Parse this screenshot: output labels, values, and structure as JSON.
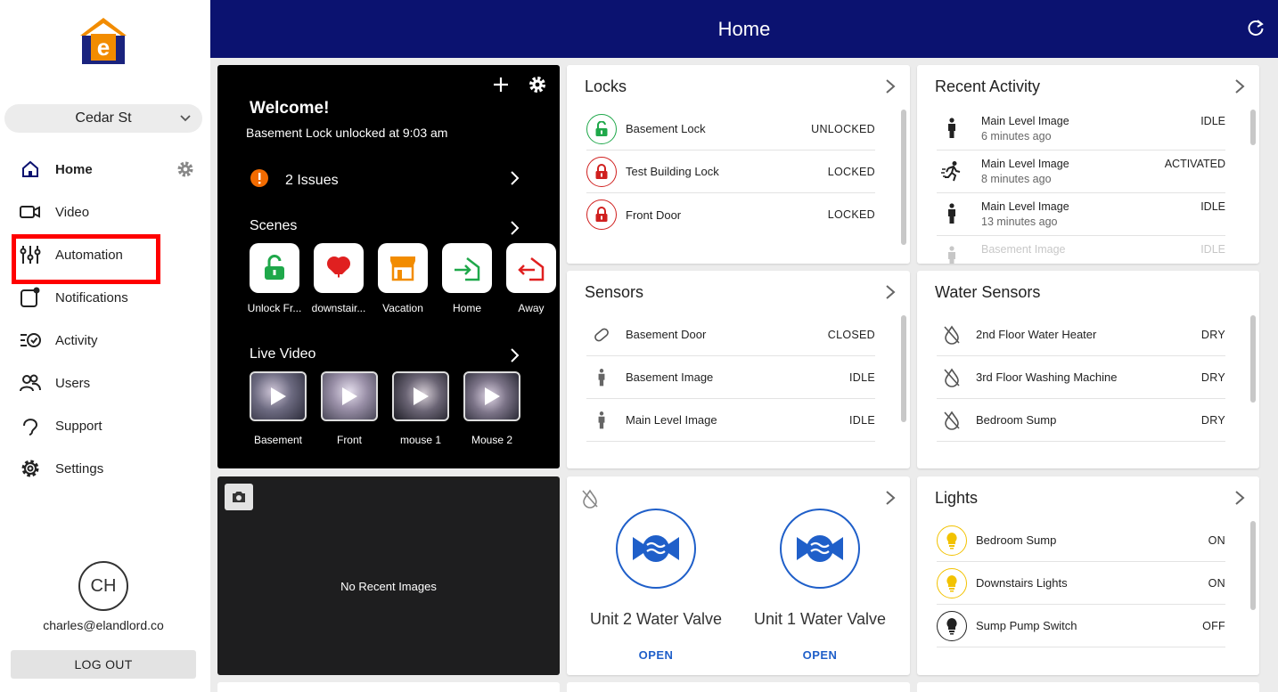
{
  "header": {
    "title": "Home"
  },
  "sidebar": {
    "property": "Cedar St",
    "nav": [
      {
        "label": "Home"
      },
      {
        "label": "Video"
      },
      {
        "label": "Automation"
      },
      {
        "label": "Notifications"
      },
      {
        "label": "Activity"
      },
      {
        "label": "Users"
      },
      {
        "label": "Support"
      },
      {
        "label": "Settings"
      }
    ],
    "avatar_initials": "CH",
    "email": "charles@elandlord.co",
    "logout_label": "LOG OUT"
  },
  "welcome": {
    "title": "Welcome!",
    "subtitle": "Basement Lock unlocked at 9:03 am",
    "issues": "2 Issues",
    "scenes_title": "Scenes",
    "scenes": [
      {
        "label": "Unlock Fr..."
      },
      {
        "label": "downstair..."
      },
      {
        "label": "Vacation"
      },
      {
        "label": "Home"
      },
      {
        "label": "Away"
      }
    ],
    "video_title": "Live Video",
    "videos": [
      {
        "label": "Basement"
      },
      {
        "label": "Front"
      },
      {
        "label": "mouse 1"
      },
      {
        "label": "Mouse 2"
      }
    ]
  },
  "locks": {
    "title": "Locks",
    "items": [
      {
        "label": "Basement Lock",
        "status": "UNLOCKED"
      },
      {
        "label": "Test Building Lock",
        "status": "LOCKED"
      },
      {
        "label": "Front Door",
        "status": "LOCKED"
      }
    ]
  },
  "activity": {
    "title": "Recent Activity",
    "items": [
      {
        "label": "Main Level Image",
        "time": "6 minutes ago",
        "status": "IDLE"
      },
      {
        "label": "Main Level Image",
        "time": "8 minutes ago",
        "status": "ACTIVATED"
      },
      {
        "label": "Main Level Image",
        "time": "13 minutes ago",
        "status": "IDLE"
      },
      {
        "label": "Basement Image",
        "status": "IDLE"
      }
    ]
  },
  "sensors": {
    "title": "Sensors",
    "items": [
      {
        "label": "Basement Door",
        "status": "CLOSED"
      },
      {
        "label": "Basement Image",
        "status": "IDLE"
      },
      {
        "label": "Main Level Image",
        "status": "IDLE"
      }
    ]
  },
  "water_sensors": {
    "title": "Water Sensors",
    "items": [
      {
        "label": "2nd Floor Water Heater",
        "status": "DRY"
      },
      {
        "label": "3rd Floor Washing Machine",
        "status": "DRY"
      },
      {
        "label": "Bedroom Sump",
        "status": "DRY"
      }
    ]
  },
  "images": {
    "empty_text": "No Recent Images"
  },
  "valves": {
    "items": [
      {
        "label": "Unit 2 Water Valve",
        "state": "OPEN"
      },
      {
        "label": "Unit 1 Water Valve",
        "state": "OPEN"
      }
    ]
  },
  "lights": {
    "title": "Lights",
    "items": [
      {
        "label": "Bedroom Sump",
        "status": "ON"
      },
      {
        "label": "Downstairs Lights",
        "status": "ON"
      },
      {
        "label": "Sump Pump Switch",
        "status": "OFF"
      }
    ]
  },
  "colors": {
    "header": "#0b1270",
    "unlocked": "#1fa84a",
    "locked": "#d0201f",
    "valve": "#1f5fc9",
    "light_on": "#f2c200",
    "highlight": "#ff0000"
  }
}
